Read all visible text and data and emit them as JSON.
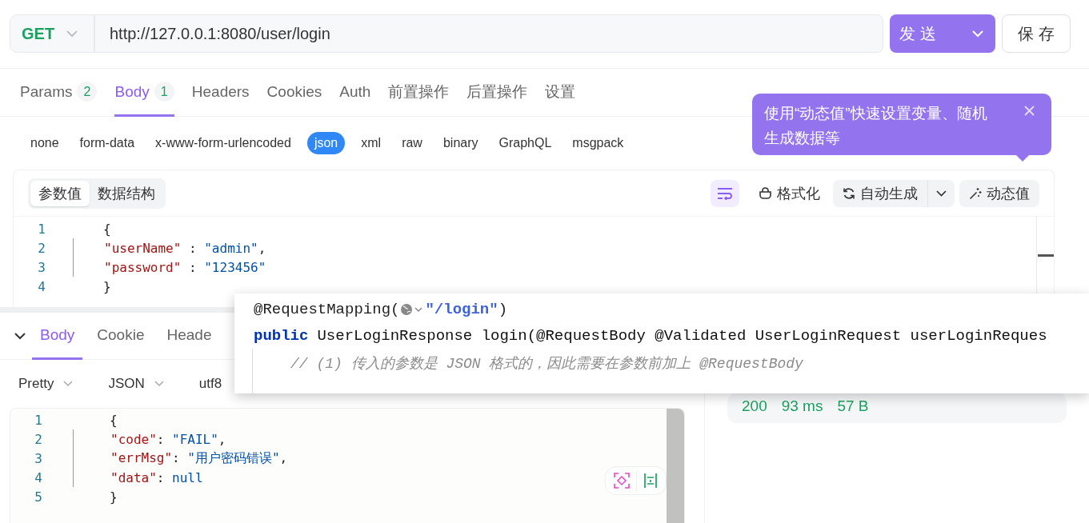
{
  "request_bar": {
    "method": "GET",
    "url": "http://127.0.0.1:8080/user/login",
    "send_button": "发 送",
    "save_button": "保 存"
  },
  "request_tabs": [
    {
      "label": "Params",
      "count": "2",
      "selected": false
    },
    {
      "label": "Body",
      "count": "1",
      "selected": true
    },
    {
      "label": "Headers",
      "selected": false
    },
    {
      "label": "Cookies",
      "selected": false
    },
    {
      "label": "Auth",
      "selected": false
    },
    {
      "label": "前置操作",
      "selected": false
    },
    {
      "label": "后置操作",
      "selected": false
    },
    {
      "label": "设置",
      "selected": false
    }
  ],
  "body_types": [
    {
      "label": "none",
      "selected": false
    },
    {
      "label": "form-data",
      "selected": false
    },
    {
      "label": "x-www-form-urlencoded",
      "selected": false
    },
    {
      "label": "json",
      "selected": true
    },
    {
      "label": "xml",
      "selected": false
    },
    {
      "label": "raw",
      "selected": false
    },
    {
      "label": "binary",
      "selected": false
    },
    {
      "label": "GraphQL",
      "selected": false
    },
    {
      "label": "msgpack",
      "selected": false
    }
  ],
  "tooltip": {
    "text": "使用“动态值”快速设置变量、随机生成数据等"
  },
  "body_editor": {
    "view_toggle": [
      {
        "label": "参数值",
        "selected": true
      },
      {
        "label": "数据结构",
        "selected": false
      }
    ],
    "format_button": "格式化",
    "generate_button": "自动生成",
    "dynamic_button": "动态值",
    "lines": [
      {
        "number": "1",
        "indented": false,
        "tokens": [
          {
            "kind": "punct",
            "text": "{"
          }
        ]
      },
      {
        "number": "2",
        "indented": true,
        "tokens": [
          {
            "kind": "key",
            "text": "\"userName\""
          },
          {
            "kind": "punct",
            "text": " : "
          },
          {
            "kind": "string",
            "text": "\"admin\""
          },
          {
            "kind": "punct",
            "text": ","
          }
        ]
      },
      {
        "number": "3",
        "indented": true,
        "tokens": [
          {
            "kind": "key",
            "text": "\"password\""
          },
          {
            "kind": "punct",
            "text": " : "
          },
          {
            "kind": "string",
            "text": "\"123456\""
          }
        ]
      },
      {
        "number": "4",
        "indented": false,
        "tokens": [
          {
            "kind": "punct",
            "text": "}"
          }
        ]
      }
    ]
  },
  "response": {
    "tabs": [
      {
        "label": "Body",
        "selected": true
      },
      {
        "label": "Cookie",
        "selected": false
      },
      {
        "label": "Heade",
        "selected": false
      }
    ],
    "format_controls": [
      {
        "label": "Pretty",
        "dropdown": true
      },
      {
        "label": "JSON",
        "dropdown": true
      },
      {
        "label": "utf8",
        "dropdown": false
      }
    ],
    "lines": [
      {
        "number": "1",
        "indented": false,
        "tokens": [
          {
            "kind": "punct",
            "text": "{"
          }
        ]
      },
      {
        "number": "2",
        "indented": true,
        "tokens": [
          {
            "kind": "key",
            "text": "\"code\""
          },
          {
            "kind": "punct",
            "text": ": "
          },
          {
            "kind": "string",
            "text": "\"FAIL\""
          },
          {
            "kind": "punct",
            "text": ","
          }
        ]
      },
      {
        "number": "3",
        "indented": true,
        "tokens": [
          {
            "kind": "key",
            "text": "\"errMsg\""
          },
          {
            "kind": "punct",
            "text": ": "
          },
          {
            "kind": "string",
            "text": "\"用户密码错误\""
          },
          {
            "kind": "punct",
            "text": ","
          }
        ]
      },
      {
        "number": "4",
        "indented": true,
        "tokens": [
          {
            "kind": "key",
            "text": "\"data\""
          },
          {
            "kind": "punct",
            "text": ": "
          },
          {
            "kind": "string",
            "text": "null"
          }
        ]
      },
      {
        "number": "5",
        "indented": false,
        "tokens": [
          {
            "kind": "punct",
            "text": "}"
          }
        ]
      }
    ],
    "status": {
      "code": "200",
      "time": "93 ms",
      "size": "57 B"
    }
  },
  "code_popup": {
    "annotation": "@RequestMapping(",
    "path": "\"/login\"",
    "annotation_end": ")",
    "keyword": "public",
    "signature": "UserLoginResponse login(@RequestBody @Validated UserLoginRequest userLoginReques",
    "comment": "// (1) 传入的参数是 JSON 格式的，因此需要在参数前加上 @RequestBody"
  }
}
